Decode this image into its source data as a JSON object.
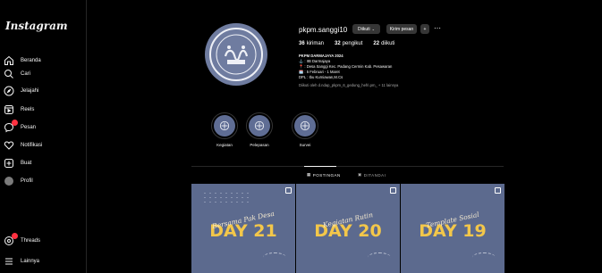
{
  "brand": {
    "logo_text": "Instagram"
  },
  "sidebar": {
    "items": [
      {
        "label": "Beranda",
        "icon": "home-icon"
      },
      {
        "label": "Cari",
        "icon": "search-icon"
      },
      {
        "label": "Jelajahi",
        "icon": "explore-icon"
      },
      {
        "label": "Reels",
        "icon": "reels-icon"
      },
      {
        "label": "Pesan",
        "icon": "messenger-icon",
        "badge": true
      },
      {
        "label": "Notifikasi",
        "icon": "heart-icon"
      },
      {
        "label": "Buat",
        "icon": "create-icon"
      },
      {
        "label": "Profil",
        "icon": "profile-avatar-icon"
      }
    ],
    "bottom": [
      {
        "label": "Threads",
        "icon": "threads-icon",
        "badge": true
      },
      {
        "label": "Lainnya",
        "icon": "menu-icon"
      }
    ]
  },
  "profile": {
    "username": "pkpm.sanggi10",
    "following_button": "Diikuti",
    "message_button": "Kirim pesan",
    "stats": {
      "posts_count": "36",
      "posts_label": "kiriman",
      "followers_count": "32",
      "followers_label": "pengikut",
      "following_count": "22",
      "following_label": "diikuti"
    },
    "bio": {
      "name": "PKPM DARMAJAYA 2024",
      "line1": "⚓ : IIB Darmajaya",
      "line2": "📍 : Desa Sanggi Kec. Padang Cermin Kab. Pesawaran",
      "line3": "🗓️ : 5 Februari - 1 Maret",
      "line4": "DPL : Ibu Kurniawan,M.Cs",
      "followed_by": "Diikuti oleh d.ndap_pkpm_6_gedung_hefri.pm_ + 11 lainnya"
    }
  },
  "highlights": [
    {
      "label": "Kegiatan"
    },
    {
      "label": "Pelepasan"
    },
    {
      "label": "Survei"
    }
  ],
  "tabs": {
    "posts": "POSTINGAN",
    "tagged": "DITANDAI"
  },
  "posts": [
    {
      "day": "DAY 21",
      "script": "Bersama Pak Desa"
    },
    {
      "day": "DAY 20",
      "script": "Kegiatan Rutin"
    },
    {
      "day": "DAY 19",
      "script": "Template Sosial"
    }
  ],
  "colors": {
    "background": "#000000",
    "button": "#363636",
    "badge": "#ff3040",
    "post_bg": "#5c6a8e",
    "day_text": "#f3c74a"
  }
}
